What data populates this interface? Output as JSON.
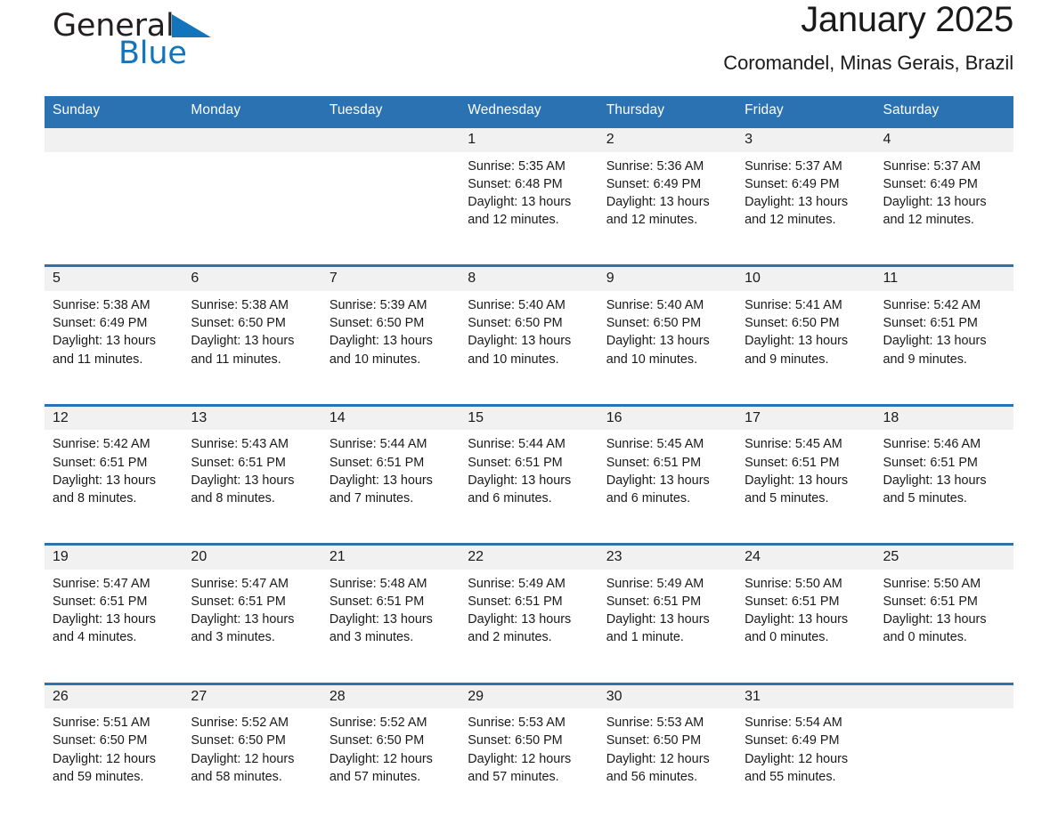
{
  "brand": {
    "name_part1": "General",
    "name_part2": "Blue",
    "triangle_icon": "triangle-icon",
    "accent_color": "#1275bc"
  },
  "header": {
    "title": "January 2025",
    "subtitle": "Coromandel, Minas Gerais, Brazil",
    "header_bg_color": "#2b72b3",
    "daynum_band_color": "#f1f1f1"
  },
  "weekday_headers": [
    "Sunday",
    "Monday",
    "Tuesday",
    "Wednesday",
    "Thursday",
    "Friday",
    "Saturday"
  ],
  "weeks": [
    [
      {
        "day": "",
        "sunrise": "",
        "sunset": "",
        "daylight1": "",
        "daylight2": ""
      },
      {
        "day": "",
        "sunrise": "",
        "sunset": "",
        "daylight1": "",
        "daylight2": ""
      },
      {
        "day": "",
        "sunrise": "",
        "sunset": "",
        "daylight1": "",
        "daylight2": ""
      },
      {
        "day": "1",
        "sunrise": "Sunrise: 5:35 AM",
        "sunset": "Sunset: 6:48 PM",
        "daylight1": "Daylight: 13 hours",
        "daylight2": "and 12 minutes."
      },
      {
        "day": "2",
        "sunrise": "Sunrise: 5:36 AM",
        "sunset": "Sunset: 6:49 PM",
        "daylight1": "Daylight: 13 hours",
        "daylight2": "and 12 minutes."
      },
      {
        "day": "3",
        "sunrise": "Sunrise: 5:37 AM",
        "sunset": "Sunset: 6:49 PM",
        "daylight1": "Daylight: 13 hours",
        "daylight2": "and 12 minutes."
      },
      {
        "day": "4",
        "sunrise": "Sunrise: 5:37 AM",
        "sunset": "Sunset: 6:49 PM",
        "daylight1": "Daylight: 13 hours",
        "daylight2": "and 12 minutes."
      }
    ],
    [
      {
        "day": "5",
        "sunrise": "Sunrise: 5:38 AM",
        "sunset": "Sunset: 6:49 PM",
        "daylight1": "Daylight: 13 hours",
        "daylight2": "and 11 minutes."
      },
      {
        "day": "6",
        "sunrise": "Sunrise: 5:38 AM",
        "sunset": "Sunset: 6:50 PM",
        "daylight1": "Daylight: 13 hours",
        "daylight2": "and 11 minutes."
      },
      {
        "day": "7",
        "sunrise": "Sunrise: 5:39 AM",
        "sunset": "Sunset: 6:50 PM",
        "daylight1": "Daylight: 13 hours",
        "daylight2": "and 10 minutes."
      },
      {
        "day": "8",
        "sunrise": "Sunrise: 5:40 AM",
        "sunset": "Sunset: 6:50 PM",
        "daylight1": "Daylight: 13 hours",
        "daylight2": "and 10 minutes."
      },
      {
        "day": "9",
        "sunrise": "Sunrise: 5:40 AM",
        "sunset": "Sunset: 6:50 PM",
        "daylight1": "Daylight: 13 hours",
        "daylight2": "and 10 minutes."
      },
      {
        "day": "10",
        "sunrise": "Sunrise: 5:41 AM",
        "sunset": "Sunset: 6:50 PM",
        "daylight1": "Daylight: 13 hours",
        "daylight2": "and 9 minutes."
      },
      {
        "day": "11",
        "sunrise": "Sunrise: 5:42 AM",
        "sunset": "Sunset: 6:51 PM",
        "daylight1": "Daylight: 13 hours",
        "daylight2": "and 9 minutes."
      }
    ],
    [
      {
        "day": "12",
        "sunrise": "Sunrise: 5:42 AM",
        "sunset": "Sunset: 6:51 PM",
        "daylight1": "Daylight: 13 hours",
        "daylight2": "and 8 minutes."
      },
      {
        "day": "13",
        "sunrise": "Sunrise: 5:43 AM",
        "sunset": "Sunset: 6:51 PM",
        "daylight1": "Daylight: 13 hours",
        "daylight2": "and 8 minutes."
      },
      {
        "day": "14",
        "sunrise": "Sunrise: 5:44 AM",
        "sunset": "Sunset: 6:51 PM",
        "daylight1": "Daylight: 13 hours",
        "daylight2": "and 7 minutes."
      },
      {
        "day": "15",
        "sunrise": "Sunrise: 5:44 AM",
        "sunset": "Sunset: 6:51 PM",
        "daylight1": "Daylight: 13 hours",
        "daylight2": "and 6 minutes."
      },
      {
        "day": "16",
        "sunrise": "Sunrise: 5:45 AM",
        "sunset": "Sunset: 6:51 PM",
        "daylight1": "Daylight: 13 hours",
        "daylight2": "and 6 minutes."
      },
      {
        "day": "17",
        "sunrise": "Sunrise: 5:45 AM",
        "sunset": "Sunset: 6:51 PM",
        "daylight1": "Daylight: 13 hours",
        "daylight2": "and 5 minutes."
      },
      {
        "day": "18",
        "sunrise": "Sunrise: 5:46 AM",
        "sunset": "Sunset: 6:51 PM",
        "daylight1": "Daylight: 13 hours",
        "daylight2": "and 5 minutes."
      }
    ],
    [
      {
        "day": "19",
        "sunrise": "Sunrise: 5:47 AM",
        "sunset": "Sunset: 6:51 PM",
        "daylight1": "Daylight: 13 hours",
        "daylight2": "and 4 minutes."
      },
      {
        "day": "20",
        "sunrise": "Sunrise: 5:47 AM",
        "sunset": "Sunset: 6:51 PM",
        "daylight1": "Daylight: 13 hours",
        "daylight2": "and 3 minutes."
      },
      {
        "day": "21",
        "sunrise": "Sunrise: 5:48 AM",
        "sunset": "Sunset: 6:51 PM",
        "daylight1": "Daylight: 13 hours",
        "daylight2": "and 3 minutes."
      },
      {
        "day": "22",
        "sunrise": "Sunrise: 5:49 AM",
        "sunset": "Sunset: 6:51 PM",
        "daylight1": "Daylight: 13 hours",
        "daylight2": "and 2 minutes."
      },
      {
        "day": "23",
        "sunrise": "Sunrise: 5:49 AM",
        "sunset": "Sunset: 6:51 PM",
        "daylight1": "Daylight: 13 hours",
        "daylight2": "and 1 minute."
      },
      {
        "day": "24",
        "sunrise": "Sunrise: 5:50 AM",
        "sunset": "Sunset: 6:51 PM",
        "daylight1": "Daylight: 13 hours",
        "daylight2": "and 0 minutes."
      },
      {
        "day": "25",
        "sunrise": "Sunrise: 5:50 AM",
        "sunset": "Sunset: 6:51 PM",
        "daylight1": "Daylight: 13 hours",
        "daylight2": "and 0 minutes."
      }
    ],
    [
      {
        "day": "26",
        "sunrise": "Sunrise: 5:51 AM",
        "sunset": "Sunset: 6:50 PM",
        "daylight1": "Daylight: 12 hours",
        "daylight2": "and 59 minutes."
      },
      {
        "day": "27",
        "sunrise": "Sunrise: 5:52 AM",
        "sunset": "Sunset: 6:50 PM",
        "daylight1": "Daylight: 12 hours",
        "daylight2": "and 58 minutes."
      },
      {
        "day": "28",
        "sunrise": "Sunrise: 5:52 AM",
        "sunset": "Sunset: 6:50 PM",
        "daylight1": "Daylight: 12 hours",
        "daylight2": "and 57 minutes."
      },
      {
        "day": "29",
        "sunrise": "Sunrise: 5:53 AM",
        "sunset": "Sunset: 6:50 PM",
        "daylight1": "Daylight: 12 hours",
        "daylight2": "and 57 minutes."
      },
      {
        "day": "30",
        "sunrise": "Sunrise: 5:53 AM",
        "sunset": "Sunset: 6:50 PM",
        "daylight1": "Daylight: 12 hours",
        "daylight2": "and 56 minutes."
      },
      {
        "day": "31",
        "sunrise": "Sunrise: 5:54 AM",
        "sunset": "Sunset: 6:49 PM",
        "daylight1": "Daylight: 12 hours",
        "daylight2": "and 55 minutes."
      },
      {
        "day": "",
        "sunrise": "",
        "sunset": "",
        "daylight1": "",
        "daylight2": ""
      }
    ]
  ]
}
